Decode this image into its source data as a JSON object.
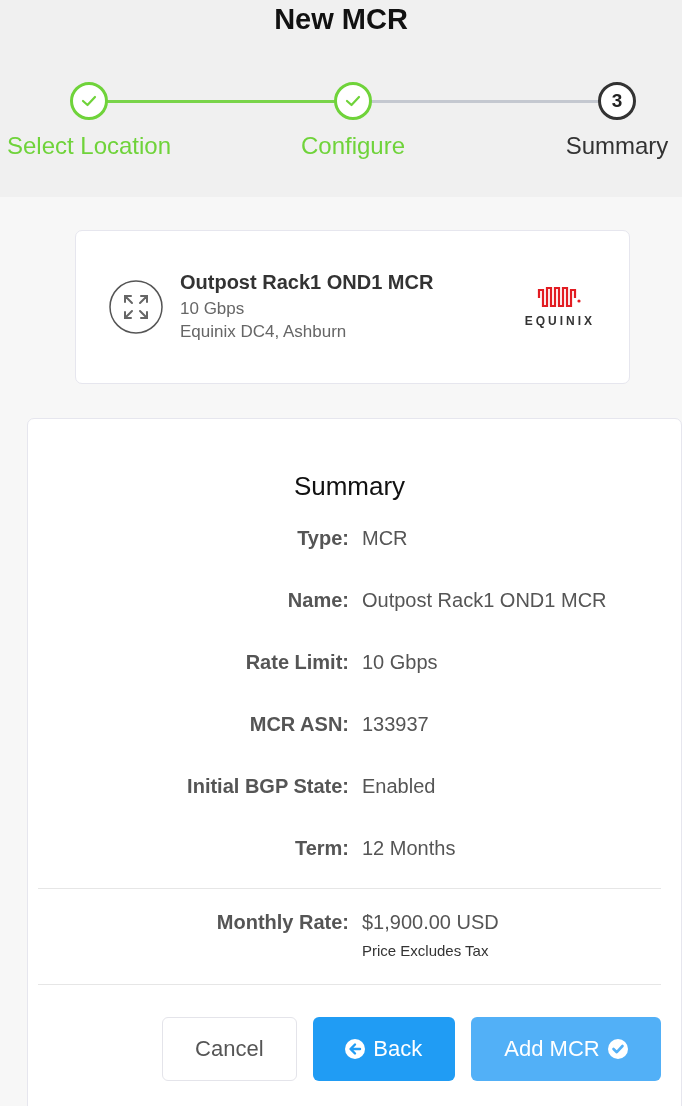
{
  "title": "New MCR",
  "steps": [
    {
      "label": "Select Location",
      "completed": true,
      "current": false
    },
    {
      "label": "Configure",
      "completed": true,
      "current": false
    },
    {
      "label": "Summary",
      "completed": false,
      "current": true,
      "number": "3"
    }
  ],
  "port_card": {
    "name": "Outpost Rack1 OND1 MCR",
    "speed": "10 Gbps",
    "location": "Equinix DC4, Ashburn",
    "logo_text": "EQUINIX"
  },
  "summary": {
    "title": "Summary",
    "rows": [
      {
        "label": "Type:",
        "value": "MCR"
      },
      {
        "label": "Name:",
        "value": "Outpost Rack1 OND1 MCR"
      },
      {
        "label": "Rate Limit:",
        "value": "10 Gbps"
      },
      {
        "label": "MCR ASN:",
        "value": "133937"
      },
      {
        "label": "Initial BGP State:",
        "value": "Enabled"
      },
      {
        "label": "Term:",
        "value": "12 Months"
      }
    ],
    "monthly_rate": {
      "label": "Monthly Rate:",
      "value": "$1,900.00 USD",
      "note": "Price Excludes Tax"
    }
  },
  "buttons": [
    {
      "label": "Cancel",
      "kind": "cancel",
      "disabled": false
    },
    {
      "label": "Back",
      "kind": "back",
      "disabled": false
    },
    {
      "label": "Add MCR",
      "kind": "submit",
      "disabled": true
    }
  ]
}
